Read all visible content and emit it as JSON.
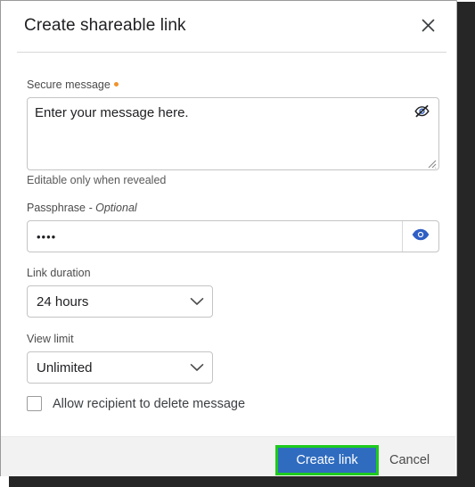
{
  "dialog": {
    "title": "Create shareable link",
    "close_icon": "close-icon"
  },
  "secure_message": {
    "label": "Secure message",
    "required_marker": "required-dot",
    "value": "Enter your message here.",
    "placeholder": "Enter your message here.",
    "helper_text": "Editable only when revealed",
    "toggle_icon": "eye-off-icon"
  },
  "passphrase": {
    "label": "Passphrase",
    "optional_suffix": "- Optional",
    "value": "••••",
    "placeholder": "",
    "reveal_icon": "eye-icon"
  },
  "link_duration": {
    "label": "Link duration",
    "selected": "24 hours",
    "chevron_icon": "chevron-down-icon",
    "options": [
      "24 hours"
    ]
  },
  "view_limit": {
    "label": "View limit",
    "selected": "Unlimited",
    "chevron_icon": "chevron-down-icon",
    "options": [
      "Unlimited"
    ]
  },
  "allow_delete": {
    "label": "Allow recipient to delete message",
    "checked": false
  },
  "footer": {
    "primary_label": "Create link",
    "secondary_label": "Cancel"
  },
  "colors": {
    "primary_button": "#2f6cbf",
    "highlight_ring": "#1ecb1e",
    "required_dot": "#f0932b",
    "reveal_icon": "#2f5fc4",
    "footer_background": "#f2f2f2",
    "window_shadow": "#262626"
  }
}
